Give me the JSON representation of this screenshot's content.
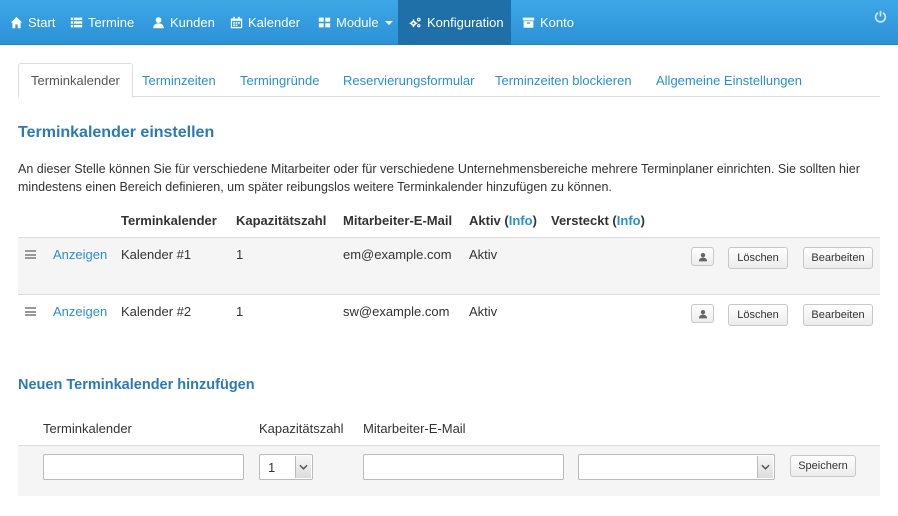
{
  "navbar": {
    "items": [
      {
        "label": "Start",
        "icon": "home-icon"
      },
      {
        "label": "Termine",
        "icon": "list-icon"
      },
      {
        "label": "Kunden",
        "icon": "user-icon"
      },
      {
        "label": "Kalender",
        "icon": "calendar-icon"
      },
      {
        "label": "Module",
        "icon": "grid-icon"
      },
      {
        "label": "Konfiguration",
        "icon": "gears-icon"
      },
      {
        "label": "Konto",
        "icon": "archive-icon"
      }
    ],
    "active": "Konfiguration"
  },
  "tabs": [
    "Terminkalender",
    "Terminzeiten",
    "Termingründe",
    "Reservierungsformular",
    "Terminzeiten blockieren",
    "Allgemeine Einstellungen"
  ],
  "section": {
    "title": "Terminkalender einstellen",
    "description": "An dieser Stelle können Sie für verschiedene Mitarbeiter oder für verschiedene Unternehmensbereiche mehrere Terminplaner einrichten. Sie sollten hier mindestens einen Bereich definieren, um später reibungslos weitere Terminkalender hinzufügen zu können."
  },
  "table": {
    "headers": {
      "calendar": "Terminkalender",
      "capacity": "Kapazitätszahl",
      "email": "Mitarbeiter-E-Mail",
      "active_prefix": "Aktiv (",
      "active_info": "Info",
      "active_suffix": ")",
      "hidden_prefix": "Versteckt (",
      "hidden_info": "Info",
      "hidden_suffix": ")"
    },
    "rows": [
      {
        "show": "Anzeigen",
        "name": "Kalender #1",
        "capacity": "1",
        "email": "em@example.com",
        "status": "Aktiv",
        "delete": "Löschen",
        "edit": "Bearbeiten"
      },
      {
        "show": "Anzeigen",
        "name": "Kalender #2",
        "capacity": "1",
        "email": "sw@example.com",
        "status": "Aktiv",
        "delete": "Löschen",
        "edit": "Bearbeiten"
      }
    ]
  },
  "add_form": {
    "title": "Neuen Terminkalender hinzufügen",
    "label_calendar": "Terminkalender",
    "label_capacity": "Kapazitätszahl",
    "label_email": "Mitarbeiter-E-Mail",
    "calendar_value": "",
    "capacity_value": "1",
    "email_value": "",
    "status_value": "",
    "save": "Speichern"
  },
  "colors": {
    "navbar": "#3ea7e6",
    "navbar_active": "#1f6fa8",
    "link": "#2a8fd0",
    "heading": "#2a7ab9"
  }
}
